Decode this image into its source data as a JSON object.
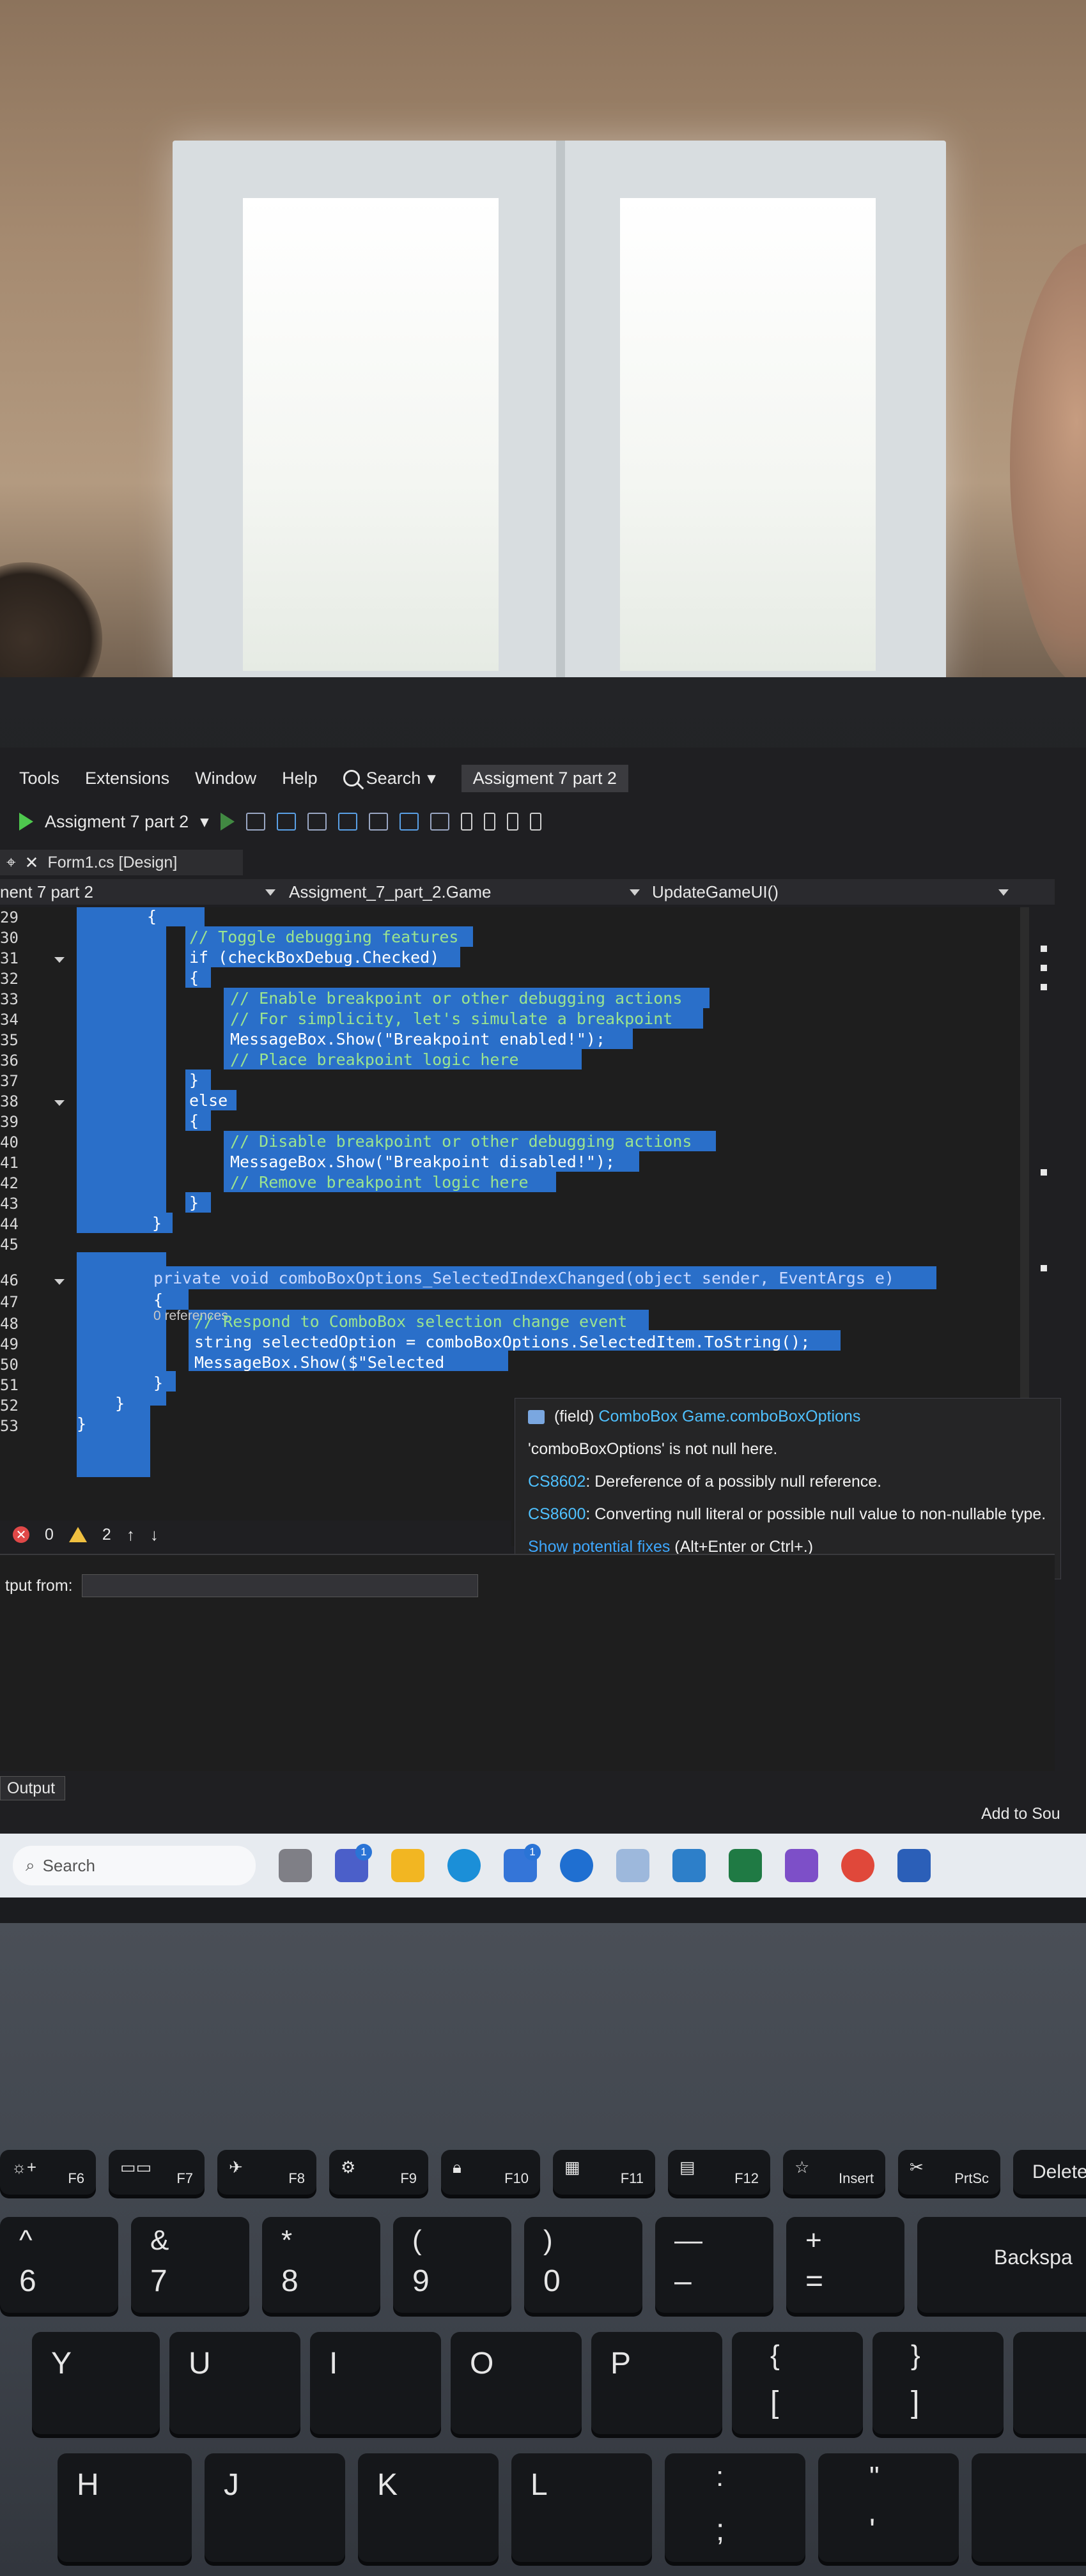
{
  "menu": {
    "items": [
      "Tools",
      "Extensions",
      "Window",
      "Help"
    ],
    "search_label": "Search",
    "solution_title": "Assigment 7 part 2"
  },
  "toolbar": {
    "startup_project": "Assigment 7 part 2"
  },
  "tabs": {
    "design_tab": "Form1.cs [Design]"
  },
  "navbar": {
    "project": "nent 7 part 2",
    "class": "Assigment_7_part_2.Game",
    "member": "UpdateGameUI()"
  },
  "editor": {
    "line_numbers": [
      "29",
      "30",
      "31",
      "32",
      "33",
      "34",
      "35",
      "36",
      "37",
      "38",
      "39",
      "40",
      "41",
      "42",
      "43",
      "44",
      "45",
      "46",
      "47",
      "48",
      "49",
      "50",
      "51",
      "52",
      "53"
    ],
    "lines": [
      "{",
      "// Toggle debugging features",
      "if (checkBoxDebug.Checked)",
      "{",
      "// Enable breakpoint or other debugging actions",
      "// For simplicity, let's simulate a breakpoint",
      "MessageBox.Show(\"Breakpoint enabled!\");",
      "// Place breakpoint logic here",
      "}",
      "else",
      "{",
      "// Disable breakpoint or other debugging actions",
      "MessageBox.Show(\"Breakpoint disabled!\");",
      "// Remove breakpoint logic here",
      "}",
      "}",
      "private void comboBoxOptions_SelectedIndexChanged(object sender, EventArgs e)",
      "{",
      "// Respond to ComboBox selection change event",
      "string selectedOption = comboBoxOptions.SelectedItem.ToString();",
      "MessageBox.Show($\"Selected",
      "}",
      "}",
      "}"
    ],
    "references": "0 references"
  },
  "tooltip": {
    "kind": "(field)",
    "signature": "ComboBox Game.comboBoxOptions",
    "null_note": "'comboBoxOptions' is not null here.",
    "warn1_code": "CS8602",
    "warn1_text": ": Dereference of a possibly null reference.",
    "warn2_code": "CS8600",
    "warn2_text": ": Converting null literal or possible null value to non-nullable type.",
    "fix_link": "Show potential fixes",
    "fix_shortcut": " (Alt+Enter or Ctrl+.)"
  },
  "status": {
    "errors": "0",
    "warnings": "2"
  },
  "output": {
    "from_label": "tput from:",
    "tab_label": "Output",
    "add_to_source": "Add to Sou"
  },
  "taskbar": {
    "search_label": "Search",
    "badge_teams": "1",
    "badge_store": "1"
  },
  "keyboard": {
    "f_keys": [
      "F6",
      "F7",
      "F8",
      "F9",
      "F10",
      "F11",
      "F12",
      "Insert",
      "PrtSc",
      "Delete"
    ],
    "number_row": [
      {
        "top": "^",
        "main": "6"
      },
      {
        "top": "&",
        "main": "7"
      },
      {
        "top": "*",
        "main": "8"
      },
      {
        "top": "(",
        "main": "9"
      },
      {
        "top": ")",
        "main": "0"
      },
      {
        "top": "—",
        "main": "–"
      },
      {
        "top": "+",
        "main": "="
      },
      {
        "top": "",
        "main": "Backspa"
      }
    ],
    "letter_row": [
      "Y",
      "U",
      "I",
      "O",
      "P"
    ],
    "bracket_keys": [
      {
        "top": "{",
        "main": "["
      },
      {
        "top": "}",
        "main": "]"
      }
    ],
    "home_row": [
      "H",
      "J",
      "K",
      "L"
    ],
    "punct_keys": [
      {
        "top": ":",
        "main": ";"
      },
      {
        "top": "\"",
        "main": "'"
      }
    ]
  },
  "colors": {
    "selection": "#2a6fc9",
    "editor_bg": "#1e1e1e",
    "link": "#3ea8ff"
  }
}
